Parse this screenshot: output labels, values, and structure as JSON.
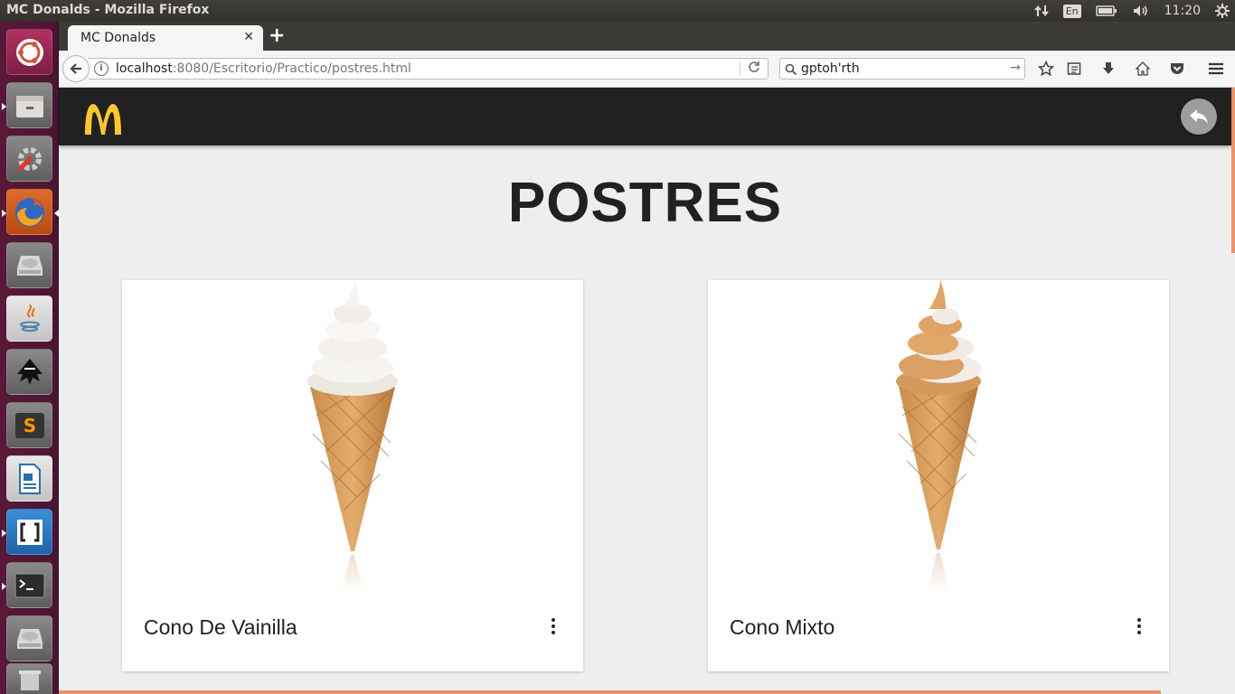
{
  "system_panel": {
    "window_title": "MC Donalds - Mozilla Firefox",
    "keyboard_layout": "En",
    "clock": "11:20"
  },
  "launcher": {
    "items": [
      "ubuntu-dash-icon",
      "files-icon",
      "system-settings-icon",
      "firefox-icon",
      "disk-icon",
      "java-icon",
      "inkscape-icon",
      "sublime-text-icon",
      "writer-icon",
      "brackets-icon",
      "terminal-icon",
      "disk-icon",
      "trash-icon"
    ]
  },
  "browser": {
    "tab_title": "MC Donalds",
    "url_host": "localhost",
    "url_rest": ":8080/Escritorio/Practico/postres.html",
    "search_text": "gptoh'rth"
  },
  "page": {
    "title": "POSTRES",
    "cards": [
      {
        "title": "Cono De Vainilla",
        "flavor": "vanilla"
      },
      {
        "title": "Cono Mixto",
        "flavor": "mixed"
      }
    ]
  },
  "colors": {
    "appbar": "#212121",
    "logo": "#ffc72c",
    "accent": "#e8916a",
    "background": "#eeeeee"
  }
}
